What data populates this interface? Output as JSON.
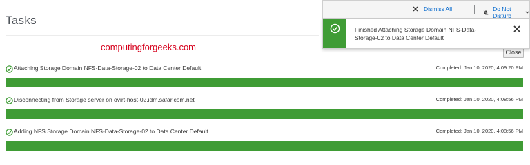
{
  "page": {
    "title": "Tasks",
    "watermark": "computingforgeeks.com",
    "close_label": "Close"
  },
  "notifications": {
    "dismiss_all_label": "Dismiss All",
    "do_not_disturb_label": "Do Not Disturb",
    "toast": {
      "status": "success",
      "message": "Finished Attaching Storage Domain NFS-Data-Storage-02 to Data Center Default"
    }
  },
  "tasks": [
    {
      "label": "Attaching Storage Domain NFS-Data-Storage-02 to Data Center Default",
      "completed": "Completed: Jan 10, 2020, 4:09:20 PM",
      "progress": 1.0,
      "status": "success"
    },
    {
      "label": "Disconnecting from Storage server on ovirt-host-02.idm.safaricom.net",
      "completed": "Completed: Jan 10, 2020, 4:08:56 PM",
      "progress": 1.0,
      "status": "success"
    },
    {
      "label": "Adding NFS Storage Domain NFS-Data-Storage-02 to Data Center Default",
      "completed": "Completed: Jan 10, 2020, 4:08:56 PM",
      "progress": 1.0,
      "status": "success"
    }
  ],
  "colors": {
    "success": "#3f9c35",
    "link": "#0066cc",
    "watermark": "#d6001c"
  }
}
